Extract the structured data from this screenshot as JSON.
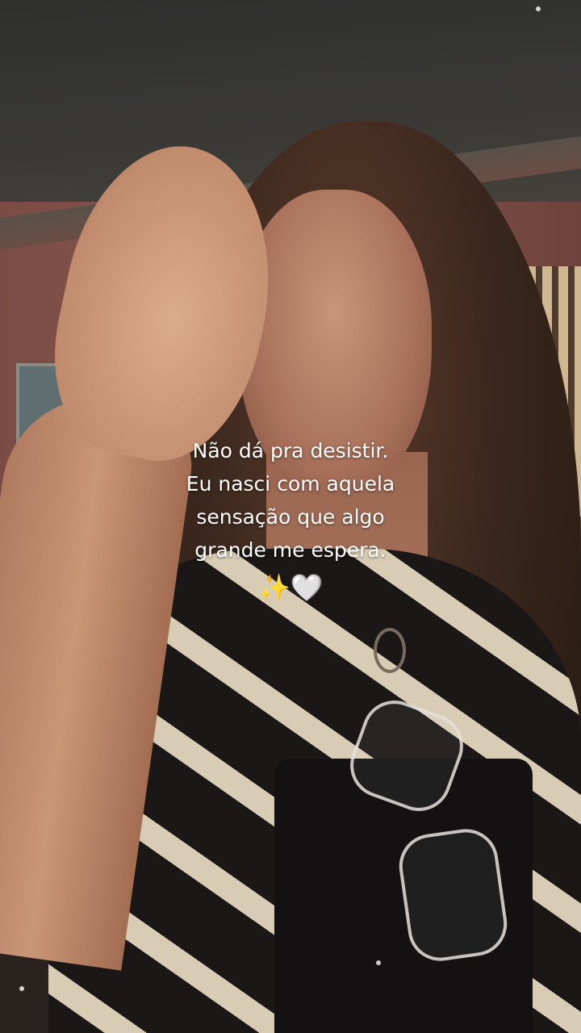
{
  "caption": {
    "lines": [
      "Não dá pra desistir.",
      "Eu nasci com aquela",
      "sensação que algo",
      "grande me espera."
    ],
    "emoji_sparkles": "✨",
    "emoji_heart": "🤍"
  },
  "colors": {
    "caption_text": "#ffffff",
    "sparkles": "#f7c948"
  }
}
